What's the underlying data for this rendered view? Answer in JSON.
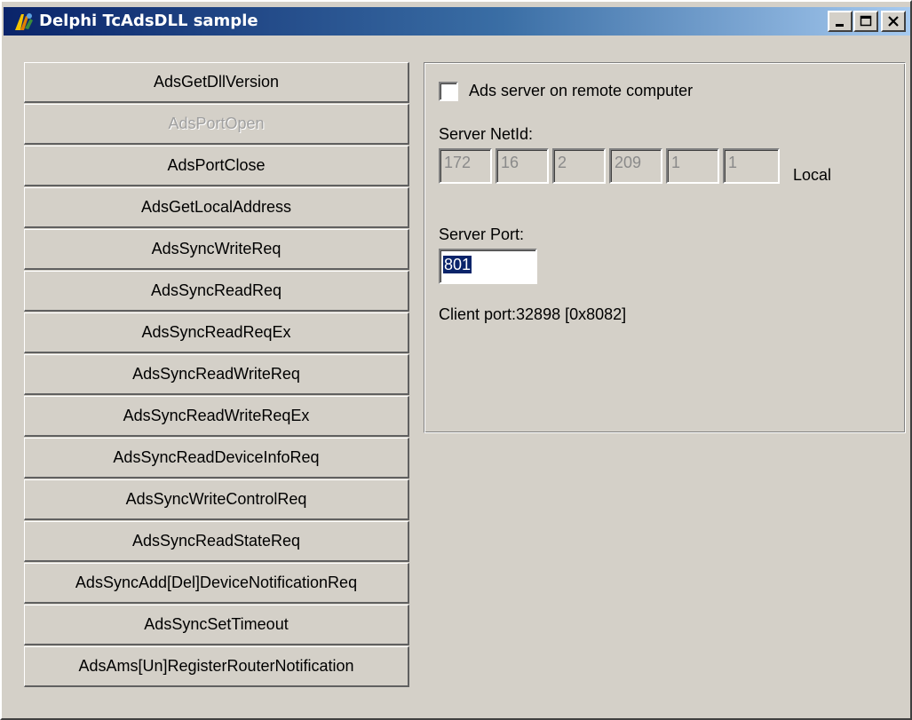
{
  "window": {
    "title": "Delphi TcAdsDLL sample"
  },
  "buttons": [
    {
      "label": "AdsGetDllVersion",
      "enabled": true
    },
    {
      "label": "AdsPortOpen",
      "enabled": false
    },
    {
      "label": "AdsPortClose",
      "enabled": true
    },
    {
      "label": "AdsGetLocalAddress",
      "enabled": true
    },
    {
      "label": "AdsSyncWriteReq",
      "enabled": true
    },
    {
      "label": "AdsSyncReadReq",
      "enabled": true
    },
    {
      "label": "AdsSyncReadReqEx",
      "enabled": true
    },
    {
      "label": "AdsSyncReadWriteReq",
      "enabled": true
    },
    {
      "label": "AdsSyncReadWriteReqEx",
      "enabled": true
    },
    {
      "label": "AdsSyncReadDeviceInfoReq",
      "enabled": true
    },
    {
      "label": "AdsSyncWriteControlReq",
      "enabled": true
    },
    {
      "label": "AdsSyncReadStateReq",
      "enabled": true
    },
    {
      "label": "AdsSyncAdd[Del]DeviceNotificationReq",
      "enabled": true
    },
    {
      "label": "AdsSyncSetTimeout",
      "enabled": true
    },
    {
      "label": "AdsAms[Un]RegisterRouterNotification",
      "enabled": true
    }
  ],
  "panel": {
    "remote_checkbox_label": "Ads server on remote computer",
    "remote_checked": false,
    "netid_label": "Server NetId:",
    "netid": [
      "172",
      "16",
      "2",
      "209",
      "1",
      "1"
    ],
    "local_label": "Local",
    "port_label": "Server Port:",
    "port_value": "801",
    "client_port": "Client port:32898 [0x8082]"
  }
}
